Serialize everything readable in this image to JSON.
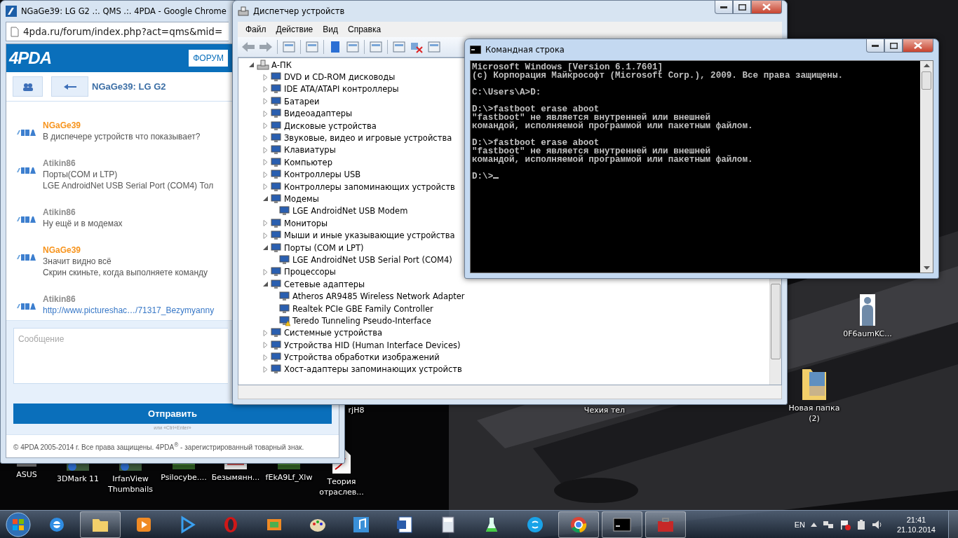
{
  "chrome": {
    "title": "NGaGe39: LG G2 .:. QMS .:. 4PDA - Google Chrome",
    "url": "4pda.ru/forum/index.php?act=qms&mid=",
    "site_logo": "4PDA",
    "forum_button": "ФОРУМ",
    "thread_title": "NGaGe39: LG G2",
    "messages": [
      {
        "author": "NGaGe39",
        "color": "#f7941d",
        "lines": [
          {
            "kind": "text",
            "text": "В диспечере устройств что показывает?"
          }
        ]
      },
      {
        "author": "Atikin86",
        "color": "#8c8c8c",
        "lines": [
          {
            "kind": "text",
            "text": "Порты(COM и LTP)"
          },
          {
            "kind": "text",
            "text": "LGE AndroidNet USB Serial Port (COM4) Тол"
          }
        ]
      },
      {
        "author": "Atikin86",
        "color": "#8c8c8c",
        "lines": [
          {
            "kind": "text",
            "text": "Ну ещё и в модемах"
          }
        ]
      },
      {
        "author": "NGaGe39",
        "color": "#f7941d",
        "lines": [
          {
            "kind": "text",
            "text": "Значит видно всё"
          },
          {
            "kind": "text",
            "text": "Скрин скиньте, когда выполняете команду"
          }
        ]
      },
      {
        "author": "Atikin86",
        "color": "#8c8c8c",
        "lines": [
          {
            "kind": "link",
            "text": "http://www.pictureshac…/71317_Bezymyanny"
          }
        ]
      }
    ],
    "message_field": {
      "placeholder": "Сообщение"
    },
    "send_button": "Отправить",
    "send_hint": "или «Ctrl+Enter»",
    "footer": "© 4PDA 2005-2014 г. Все права защищены. 4PDA$^{®}$ - зарегистрированный товарный знак."
  },
  "device_manager": {
    "title": "Диспетчер устройств",
    "menu": [
      "Файл",
      "Действие",
      "Вид",
      "Справка"
    ],
    "tree": {
      "label": "А-ПК",
      "expanded": true,
      "children": [
        {
          "label": "DVD и CD-ROM дисководы",
          "expanded": false
        },
        {
          "label": "IDE ATA/ATAPI контроллеры",
          "expanded": false
        },
        {
          "label": "Батареи",
          "expanded": false
        },
        {
          "label": "Видеоадаптеры",
          "expanded": false
        },
        {
          "label": "Дисковые устройства",
          "expanded": false
        },
        {
          "label": "Звуковые, видео и игровые устройства",
          "expanded": false
        },
        {
          "label": "Клавиатуры",
          "expanded": false
        },
        {
          "label": "Компьютер",
          "expanded": false
        },
        {
          "label": "Контроллеры USB",
          "expanded": false
        },
        {
          "label": "Контроллеры запоминающих устройств",
          "expanded": false
        },
        {
          "label": "Модемы",
          "expanded": true,
          "children": [
            {
              "label": "LGE AndroidNet USB Modem",
              "warning": false
            }
          ]
        },
        {
          "label": "Мониторы",
          "expanded": false
        },
        {
          "label": "Мыши и иные указывающие устройства",
          "expanded": false
        },
        {
          "label": "Порты (COM и LPT)",
          "expanded": true,
          "children": [
            {
              "label": "LGE AndroidNet USB Serial Port (COM4)",
              "warning": false
            }
          ]
        },
        {
          "label": "Процессоры",
          "expanded": false
        },
        {
          "label": "Сетевые адаптеры",
          "expanded": true,
          "children": [
            {
              "label": "Atheros AR9485 Wireless Network Adapter",
              "warning": false
            },
            {
              "label": "Realtek PCIe GBE Family Controller",
              "warning": false
            },
            {
              "label": "Teredo Tunneling Pseudo-Interface",
              "warning": true
            }
          ]
        },
        {
          "label": "Системные устройства",
          "expanded": false
        },
        {
          "label": "Устройства HID (Human Interface Devices)",
          "expanded": false
        },
        {
          "label": "Устройства обработки изображений",
          "expanded": false
        },
        {
          "label": "Хост-адаптеры запоминающих устройств",
          "expanded": false
        }
      ]
    }
  },
  "console": {
    "title": "Командная строка",
    "blocks": [
      [
        "Microsoft Windows [Version 6.1.7601]",
        "(c) Корпорация Майкрософт (Microsoft Corp.), 2009. Все права защищены."
      ],
      [
        "C:\\Users\\A>D:"
      ],
      [
        "D:\\>fastboot erase aboot",
        "\"fastboot\" не является внутренней или внешней",
        "командой, исполняемой программой или пакетным файлом."
      ],
      [
        "D:\\>fastboot erase aboot",
        "\"fastboot\" не является внутренней или внешней",
        "командой, исполняемой программой или пакетным файлом."
      ]
    ],
    "prompt": "D:\\>"
  },
  "desktop_icons": [
    {
      "label": "0F6aumKC..."
    },
    {
      "label": "rjH8"
    },
    {
      "label": "Чехия тел"
    },
    {
      "label": "Новая папка (2)"
    },
    {
      "label": "ASUS"
    },
    {
      "label": "3DMark 11"
    },
    {
      "label": "IrfanView Thumbnails"
    },
    {
      "label": "Psilocybe...."
    },
    {
      "label": "Безымянн..."
    },
    {
      "label": "fEkA9Lf_Xlw"
    },
    {
      "label": "Теория отраслев..."
    }
  ],
  "taskbar": {
    "apps": [
      {
        "kind": "ie",
        "open": false
      },
      {
        "kind": "explorer",
        "open": true
      },
      {
        "kind": "media",
        "open": false
      },
      {
        "kind": "play",
        "open": false
      },
      {
        "kind": "opera",
        "open": false
      },
      {
        "kind": "photos",
        "open": false
      },
      {
        "kind": "paint",
        "open": false
      },
      {
        "kind": "music",
        "open": false
      },
      {
        "kind": "word",
        "open": false
      },
      {
        "kind": "calculator",
        "open": false
      },
      {
        "kind": "flask",
        "open": false
      },
      {
        "kind": "skype",
        "open": false
      },
      {
        "kind": "chrome",
        "open": true
      },
      {
        "kind": "console",
        "open": true
      },
      {
        "kind": "toolbox",
        "open": true
      }
    ],
    "language": "EN",
    "time": "21:41",
    "date": "21.10.2014"
  }
}
